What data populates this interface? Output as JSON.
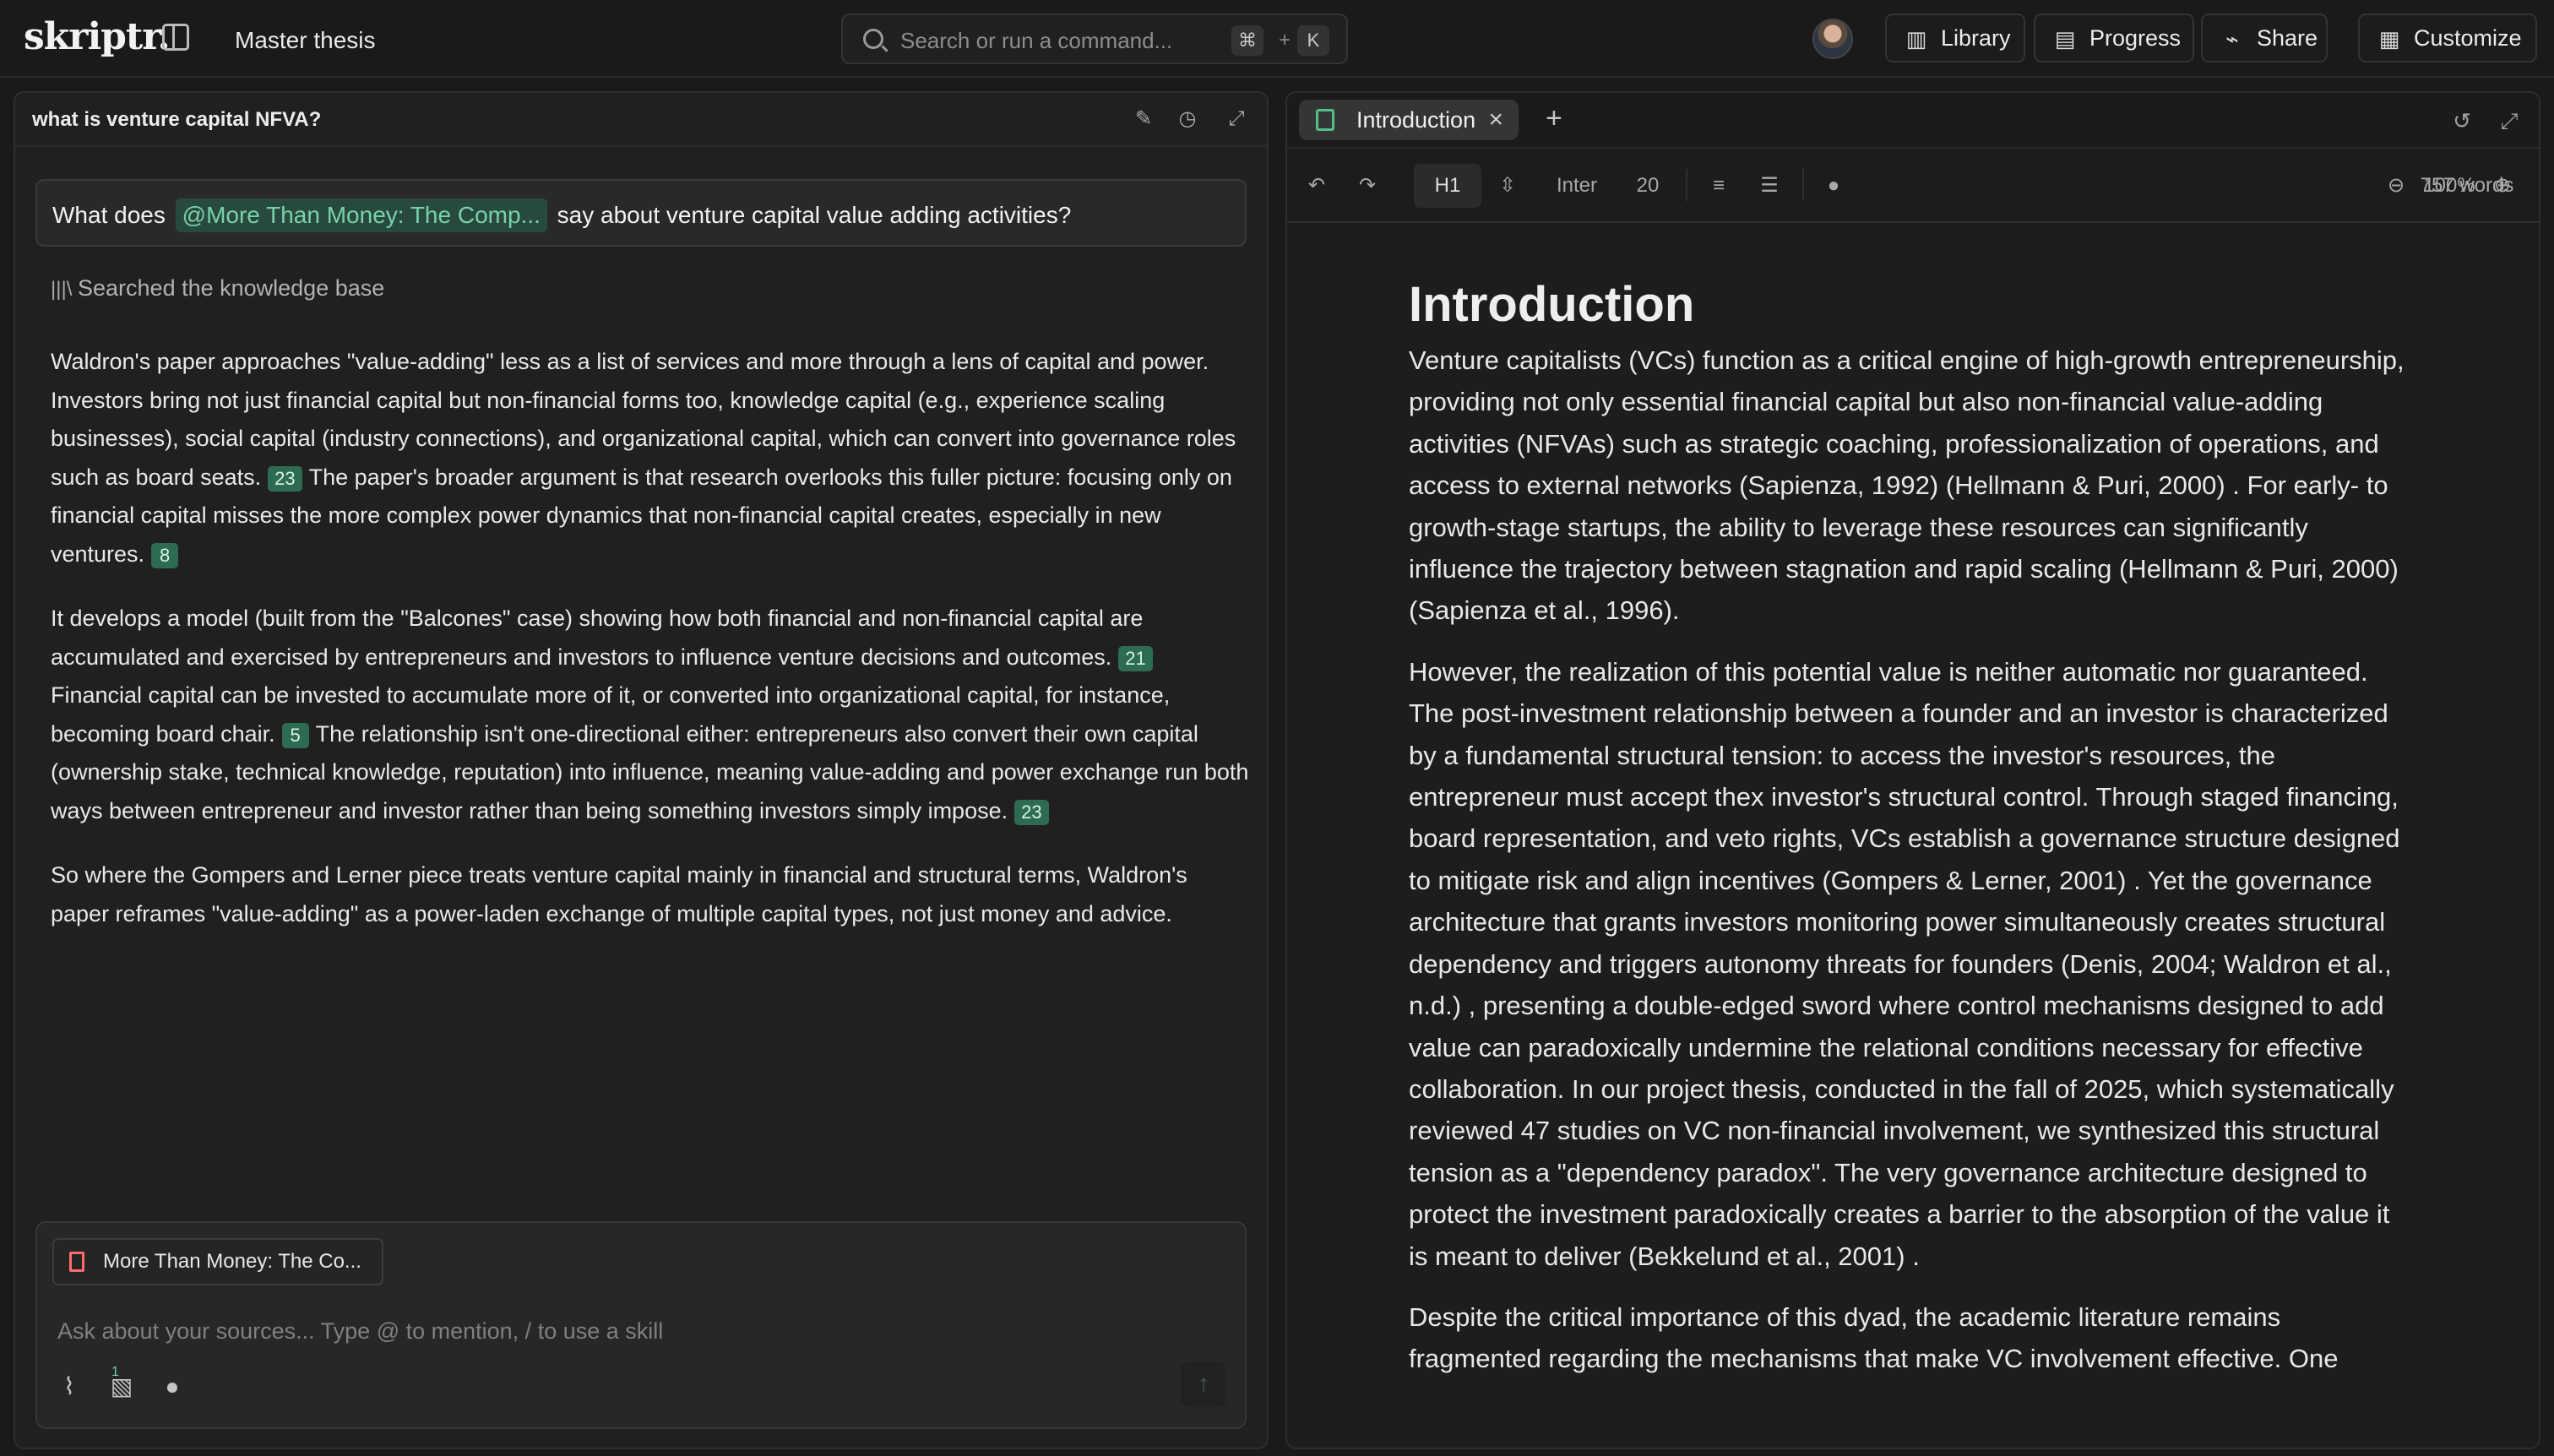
{
  "header": {
    "logo": "skriptr.",
    "project_title": "Master thesis",
    "search_placeholder": "Search or run a command...",
    "shortcut_modifier": "⌘",
    "shortcut_plus": "+",
    "shortcut_key": "K",
    "library_label": "Library",
    "progress_label": "Progress",
    "share_label": "Share",
    "customize_label": "Customize"
  },
  "chat": {
    "title": "what is venture capital NFVA?",
    "question_prefix": "What does",
    "question_mention": "@More Than Money: The Comp...",
    "question_suffix": "say about venture capital value adding activities?",
    "status": "Searched the knowledge base",
    "answer": {
      "p1_a": "Waldron's paper approaches \"value-adding\" less as a list of services and more through a lens of capital and power. Investors bring not just financial capital but non-financial forms too, knowledge capital (e.g., experience scaling businesses), social capital (industry connections), and organizational capital, which can convert into governance roles such as board seats.",
      "c1": "23",
      "p1_b": "The paper's broader argument is that research overlooks this fuller picture: focusing only on financial capital misses the more complex power dynamics that non-financial capital creates, especially in new ventures.",
      "c2": "8",
      "p2_a": "It develops a model (built from the \"Balcones\" case) showing how both financial and non-financial capital are accumulated and exercised by entrepreneurs and investors to influence venture decisions and outcomes.",
      "c3": "21",
      "p2_b": "Financial capital can be invested to accumulate more of it, or converted into organizational capital, for instance, becoming board chair.",
      "c4": "5",
      "p2_c": "The relationship isn't one-directional either: entrepreneurs also convert their own capital (ownership stake, technical knowledge, reputation) into influence, meaning value-adding and power exchange run both ways between entrepreneur and investor rather than being something investors simply impose.",
      "c5": "23",
      "p3": "So where the Gompers and Lerner piece treats venture capital mainly in financial and structural terms, Waldron's paper reframes \"value-adding\" as a power-laden exchange of multiple capital types, not just money and advice."
    },
    "source_chip": "More Than Money: The Co...",
    "composer_placeholder": "Ask about your sources... Type @ to mention, / to use a skill",
    "attachment_count": "1"
  },
  "document": {
    "tab_label": "Introduction",
    "toolbar": {
      "heading": "H1",
      "font": "Inter",
      "size": "20",
      "zoom": "100%",
      "word_count": "757 words"
    },
    "title": "Introduction",
    "p1": "Venture capitalists (VCs) function as a critical engine of high-growth entrepreneurship, providing not only essential financial capital but also non-financial value-adding activities (NFVAs) such as strategic coaching, professionalization of operations, and access to external networks (Sapienza, 1992)  (Hellmann & Puri, 2000) . For early- to growth-stage startups, the ability to leverage these resources can significantly influence the trajectory between stagnation and rapid scaling  (Hellmann & Puri, 2000)  (Sapienza et al., 1996).",
    "p2": "However, the realization of this potential value is neither automatic nor guaranteed. The post-investment relationship between a founder and an investor is characterized by a fundamental structural tension: to access the investor's resources, the entrepreneur must accept thex investor's structural control. Through staged financing, board representation, and veto rights, VCs establish a governance structure designed to mitigate risk and align incentives  (Gompers & Lerner, 2001) . Yet the governance architecture that grants investors monitoring power simultaneously creates structural dependency and triggers autonomy threats for founders  (Denis, 2004; Waldron et al., n.d.) , presenting a double-edged sword where control mechanisms designed to add value can paradoxically undermine the relational conditions necessary for effective collaboration. In our project thesis, conducted in the fall of 2025, which systematically reviewed 47 studies on VC non-financial involvement, we synthesized this structural tension as a \"dependency paradox\". The very governance architecture designed to protect the investment paradoxically creates a barrier to the absorption of the value it is meant to deliver  (Bekkelund et al., 2001) .",
    "p3": "Despite the critical importance of this dyad, the academic literature remains fragmented regarding the mechanisms that make VC involvement effective. One"
  }
}
